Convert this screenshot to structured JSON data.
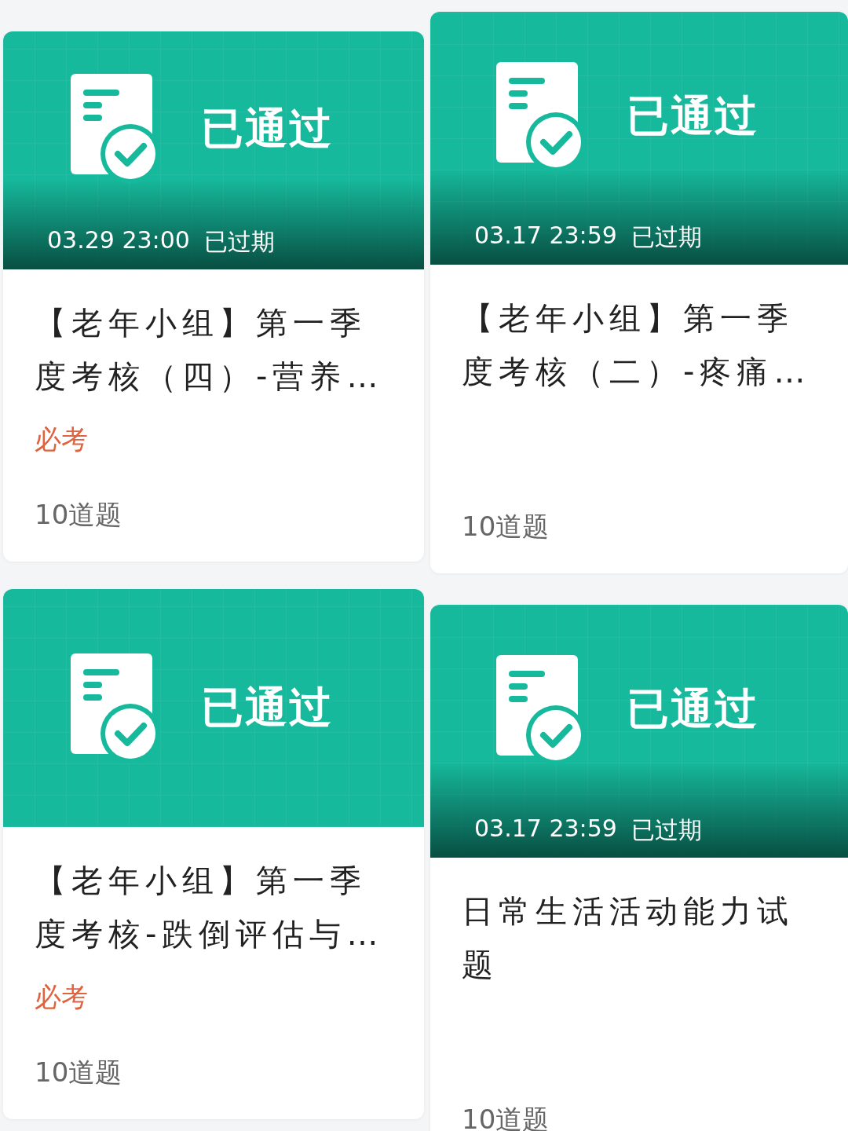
{
  "columns": [
    {
      "cards": [
        {
          "status": "已通过",
          "deadline": "03.29 23:00",
          "deadline_state": "已过期",
          "title": "【老年小组】第一季度考核（四）-营养…",
          "tag": "必考",
          "count": "10道题"
        },
        {
          "status": "已通过",
          "title": "【老年小组】第一季度考核-跌倒评估与…",
          "tag": "必考",
          "count": "10道题"
        }
      ]
    },
    {
      "cards": [
        {
          "status": "已通过",
          "deadline": "03.17 23:59",
          "deadline_state": "已过期",
          "title": "【老年小组】第一季度考核（二）-疼痛…",
          "count": "10道题"
        },
        {
          "status": "已通过",
          "deadline": "03.17 23:59",
          "deadline_state": "已过期",
          "title": "日常生活活动能力试题",
          "count": "10道题"
        }
      ]
    }
  ]
}
